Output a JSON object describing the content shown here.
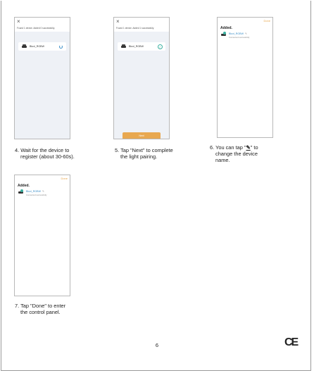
{
  "screens": {
    "s4": {
      "close": "×",
      "found": "Found 1 device. Added 0 successfully.",
      "device": "Bluxi_RGBW"
    },
    "s5": {
      "close": "×",
      "found": "Found 1 device. Added 1 successfully.",
      "device": "Bluxi_RGBW",
      "next": "Next"
    },
    "s6": {
      "done": "Done",
      "added": "Added.",
      "device": "Bluxi_RGBW",
      "status": "Connected successfully"
    },
    "s7": {
      "done": "Done",
      "added": "Added.",
      "device": "Bluxi_RGBW",
      "status": "Connected successfully"
    }
  },
  "captions": {
    "c4_l1": "4. Wait for the device to",
    "c4_l2": "register (about 30-60s).",
    "c5_l1": "5. Tap \"Next\" to complete",
    "c5_l2": "the light pairing.",
    "c6_l1": "6. You can tap \"",
    "c6_l1b": "\" to",
    "c6_l2": "change the device",
    "c6_l3": "name.",
    "c7_l1": "7. Tap \"Done\" to enter",
    "c7_l2": "the control panel."
  },
  "footer": {
    "page_number": "6",
    "ce_mark": "CE"
  },
  "colors": {
    "accent": "#e8a850",
    "link": "#3a8ec8",
    "success": "#3ab0a0",
    "screen_bg": "#eef1f6"
  }
}
